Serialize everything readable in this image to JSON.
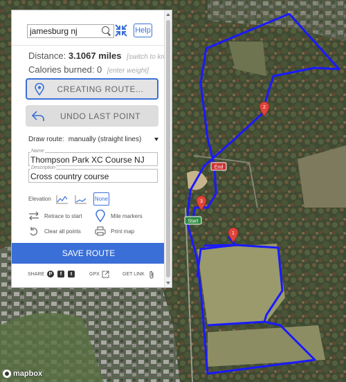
{
  "panel": {
    "search_value": "jamesburg nj",
    "help_label": "Help",
    "distance_label": "Distance:",
    "distance_value": "3.1067 miles",
    "switch_units": "[switch to km]",
    "calories_label": "Calories burned:",
    "calories_value": "0",
    "enter_weight": "[enter weight]",
    "creating_route_label": "CREATING ROUTE...",
    "undo_label": "UNDO LAST POINT",
    "draw_route_label": "Draw route:",
    "draw_route_value": "manually (straight lines)",
    "name_legend": "Name",
    "name_value": "Thompson Park XC Course NJ",
    "description_legend": "Description",
    "description_value": "Cross country course",
    "elevation_label": "Elevation",
    "none_label": "None",
    "retrace_label": "Retrace to start",
    "mile_markers_label": "Mile markers",
    "clear_label": "Clear all points",
    "print_label": "Print map",
    "save_label": "SAVE ROUTE",
    "share_label": "SHARE",
    "gpx_label": "GPX",
    "get_link_label": "GET LINK"
  },
  "map": {
    "marker_start": "Start",
    "marker_end": "End",
    "mile_markers": [
      "1",
      "2",
      "3"
    ],
    "attribution": "mapbox",
    "route_color": "#1a1aff",
    "start_color": "#2e8b3e",
    "end_color": "#cc3333",
    "marker_color": "#e0443a"
  },
  "colors": {
    "accent": "#3a6fd8"
  }
}
